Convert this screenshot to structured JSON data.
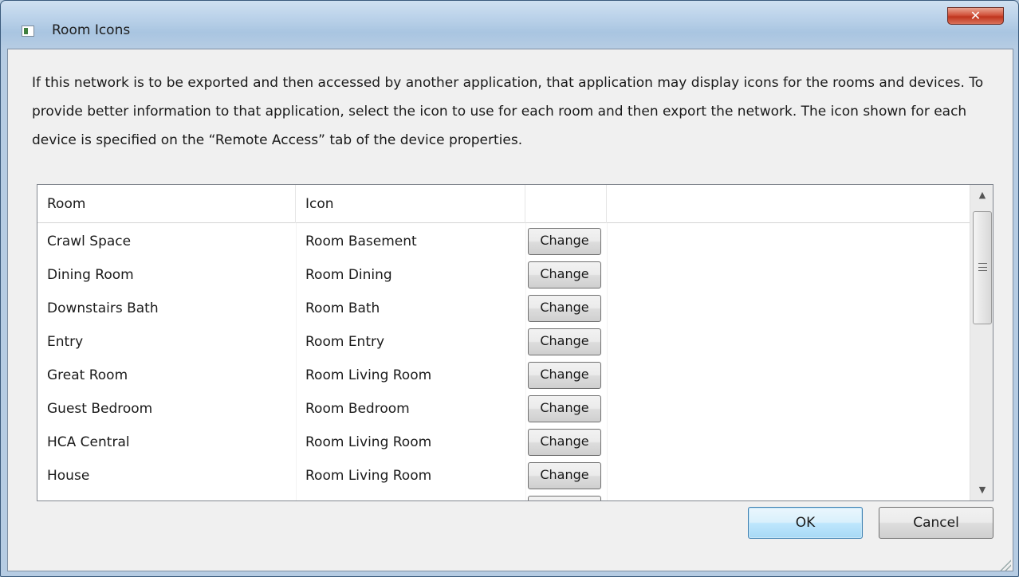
{
  "window": {
    "title": "Room Icons",
    "close_glyph": "✕"
  },
  "description": "If this network is to be exported and then accessed by another application, that application may display icons for the rooms and devices. To provide better information to that application, select the icon to use for each room and then export the network. The icon shown for each device is specified on the “Remote Access” tab of the device properties.",
  "grid": {
    "columns": [
      "Room",
      "Icon",
      ""
    ],
    "rows": [
      {
        "room": "Crawl Space",
        "icon": "Room Basement",
        "button": "Change"
      },
      {
        "room": "Dining Room",
        "icon": "Room Dining",
        "button": "Change"
      },
      {
        "room": "Downstairs Bath",
        "icon": "Room Bath",
        "button": "Change"
      },
      {
        "room": "Entry",
        "icon": "Room Entry",
        "button": "Change"
      },
      {
        "room": "Great Room",
        "icon": "Room Living Room",
        "button": "Change"
      },
      {
        "room": "Guest Bedroom",
        "icon": "Room Bedroom",
        "button": "Change"
      },
      {
        "room": "HCA Central",
        "icon": "Room Living Room",
        "button": "Change"
      },
      {
        "room": "House",
        "icon": "Room Living Room",
        "button": "Change"
      }
    ]
  },
  "buttons": {
    "ok": "OK",
    "cancel": "Cancel"
  },
  "icons": {
    "app": "room-icons-app-icon",
    "close": "close-icon",
    "scroll_up": "scroll-up-arrow-icon",
    "scroll_down": "scroll-down-arrow-icon",
    "resize": "resize-grip-icon"
  },
  "colors": {
    "close_button": "#c0351e",
    "ok_border": "#3c7fb1"
  }
}
